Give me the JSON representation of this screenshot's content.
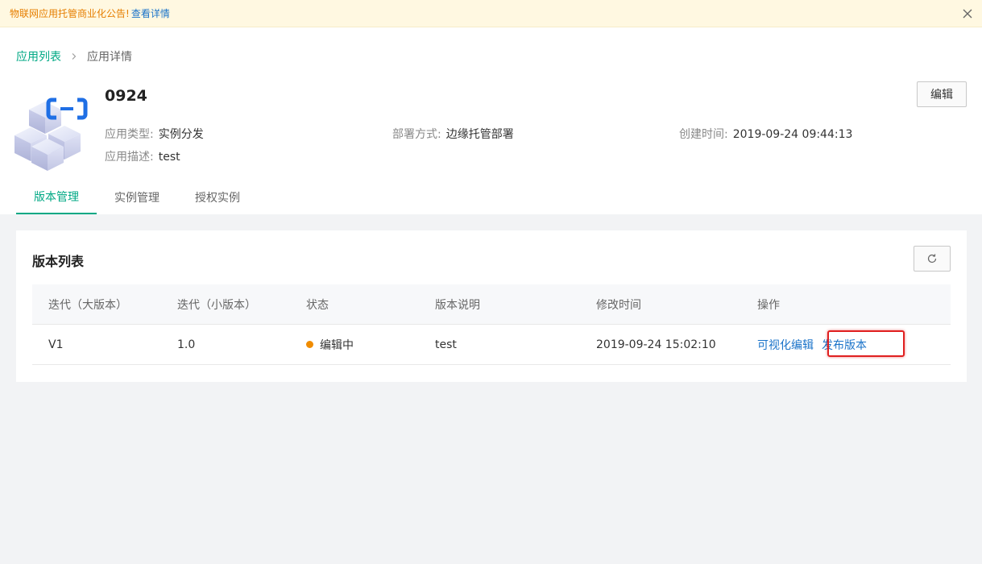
{
  "notice": {
    "text": "物联网应用托管商业化公告!",
    "link": "查看详情"
  },
  "breadcrumb": {
    "parent": "应用列表",
    "current": "应用详情"
  },
  "app": {
    "name": "0924",
    "type_label": "应用类型:",
    "type_value": "实例分发",
    "deploy_label": "部署方式:",
    "deploy_value": "边缘托管部署",
    "created_label": "创建时间:",
    "created_value": "2019-09-24 09:44:13",
    "desc_label": "应用描述:",
    "desc_value": "test"
  },
  "header": {
    "edit_label": "编辑"
  },
  "tabs": [
    {
      "label": "版本管理",
      "active": true
    },
    {
      "label": "实例管理",
      "active": false
    },
    {
      "label": "授权实例",
      "active": false
    }
  ],
  "versions": {
    "title": "版本列表",
    "columns": [
      "迭代（大版本）",
      "迭代（小版本）",
      "状态",
      "版本说明",
      "修改时间",
      "操作"
    ],
    "rows": [
      {
        "major": "V1",
        "minor": "1.0",
        "status": "编辑中",
        "description": "test",
        "modified": "2019-09-24 15:02:10",
        "action_edit": "可视化编辑",
        "action_publish": "发布版本"
      }
    ]
  },
  "colors": {
    "accent": "#00a884",
    "link": "#1a73c9",
    "status_editing": "#f08c00",
    "highlight": "#e02020"
  }
}
